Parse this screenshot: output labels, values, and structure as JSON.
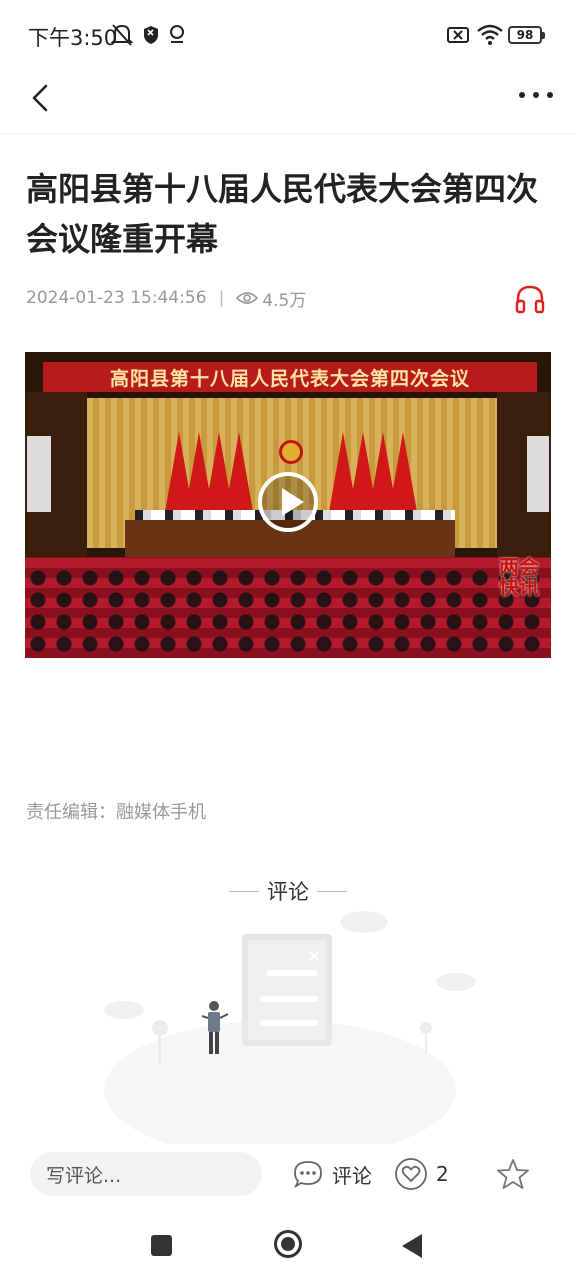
{
  "status_bar": {
    "time": "下午3:50",
    "battery": "98",
    "icons": [
      "mute-bell-icon",
      "shield-icon",
      "location-badge-icon",
      "sim-error-icon",
      "wifi-icon",
      "battery-icon"
    ]
  },
  "nav": {
    "back_icon": "chevron-left-icon",
    "more_icon": "more-dots-icon"
  },
  "article": {
    "title": "高阳县第十八届人民代表大会第四次会议隆重开幕",
    "date": "2024-01-23 15:44:56",
    "separator": "|",
    "views": "4.5万",
    "video_banner": "高阳县第十八届人民代表大会第四次会议",
    "video_stamp": "两会快讯",
    "editor": "责任编辑：融媒体手机"
  },
  "comments": {
    "header": "评论"
  },
  "toolbar": {
    "input_placeholder": "写评论...",
    "comment_label": "评论",
    "like_count": "2"
  },
  "colors": {
    "accent": "#e02020",
    "text_primary": "#222222",
    "text_secondary": "#999999"
  }
}
